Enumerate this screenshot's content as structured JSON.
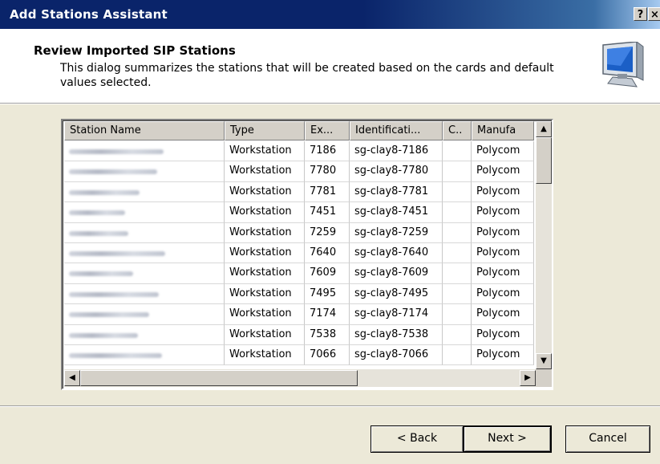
{
  "window": {
    "title": "Add Stations Assistant",
    "help_glyph": "?",
    "close_glyph": "×"
  },
  "header": {
    "title": "Review Imported SIP Stations",
    "description": "This dialog summarizes the stations that will be created based on the cards and default values selected.",
    "icon": "computer-monitor-icon"
  },
  "table": {
    "columns": [
      "Station Name",
      "Type",
      "Ex...",
      "Identificati...",
      "C..",
      "Manufa"
    ],
    "rows": [
      {
        "type": "Workstation",
        "ext": "7186",
        "identification": "sg-clay8-7186",
        "c": "",
        "manufacturer": "Polycom"
      },
      {
        "type": "Workstation",
        "ext": "7780",
        "identification": "sg-clay8-7780",
        "c": "",
        "manufacturer": "Polycom"
      },
      {
        "type": "Workstation",
        "ext": "7781",
        "identification": "sg-clay8-7781",
        "c": "",
        "manufacturer": "Polycom"
      },
      {
        "type": "Workstation",
        "ext": "7451",
        "identification": "sg-clay8-7451",
        "c": "",
        "manufacturer": "Polycom"
      },
      {
        "type": "Workstation",
        "ext": "7259",
        "identification": "sg-clay8-7259",
        "c": "",
        "manufacturer": "Polycom"
      },
      {
        "type": "Workstation",
        "ext": "7640",
        "identification": "sg-clay8-7640",
        "c": "",
        "manufacturer": "Polycom"
      },
      {
        "type": "Workstation",
        "ext": "7609",
        "identification": "sg-clay8-7609",
        "c": "",
        "manufacturer": "Polycom"
      },
      {
        "type": "Workstation",
        "ext": "7495",
        "identification": "sg-clay8-7495",
        "c": "",
        "manufacturer": "Polycom"
      },
      {
        "type": "Workstation",
        "ext": "7174",
        "identification": "sg-clay8-7174",
        "c": "",
        "manufacturer": "Polycom"
      },
      {
        "type": "Workstation",
        "ext": "7538",
        "identification": "sg-clay8-7538",
        "c": "",
        "manufacturer": "Polycom"
      },
      {
        "type": "Workstation",
        "ext": "7066",
        "identification": "sg-clay8-7066",
        "c": "",
        "manufacturer": "Polycom"
      }
    ],
    "station_names_redacted": true
  },
  "scrollbars": {
    "up_glyph": "▲",
    "down_glyph": "▼",
    "left_glyph": "◀",
    "right_glyph": "▶"
  },
  "buttons": {
    "back": "< Back",
    "next": "Next >",
    "cancel": "Cancel"
  },
  "colors": {
    "titlebar": "#0a246a",
    "dialog_face": "#ece9d8"
  }
}
